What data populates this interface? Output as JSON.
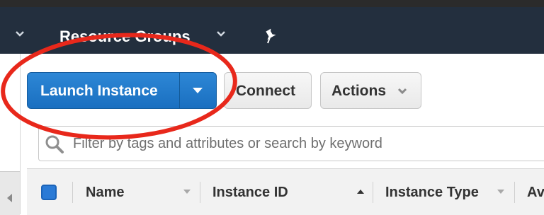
{
  "nav": {
    "title": "Resource Groups",
    "left_chevron_icon": "chevron-down-icon",
    "title_chevron_icon": "chevron-down-icon",
    "pin_icon": "pushpin-icon"
  },
  "toolbar": {
    "launch_label": "Launch Instance",
    "connect_label": "Connect",
    "actions_label": "Actions"
  },
  "search": {
    "placeholder": "Filter by tags and attributes or search by keyword",
    "value": ""
  },
  "table": {
    "columns": [
      {
        "label": "Name"
      },
      {
        "label": "Instance ID"
      },
      {
        "label": "Instance Type"
      },
      {
        "label": "Av"
      }
    ]
  },
  "colors": {
    "nav_bg": "#232f3e",
    "primary": "#1a6fc0",
    "annotation": "#e8281b"
  }
}
